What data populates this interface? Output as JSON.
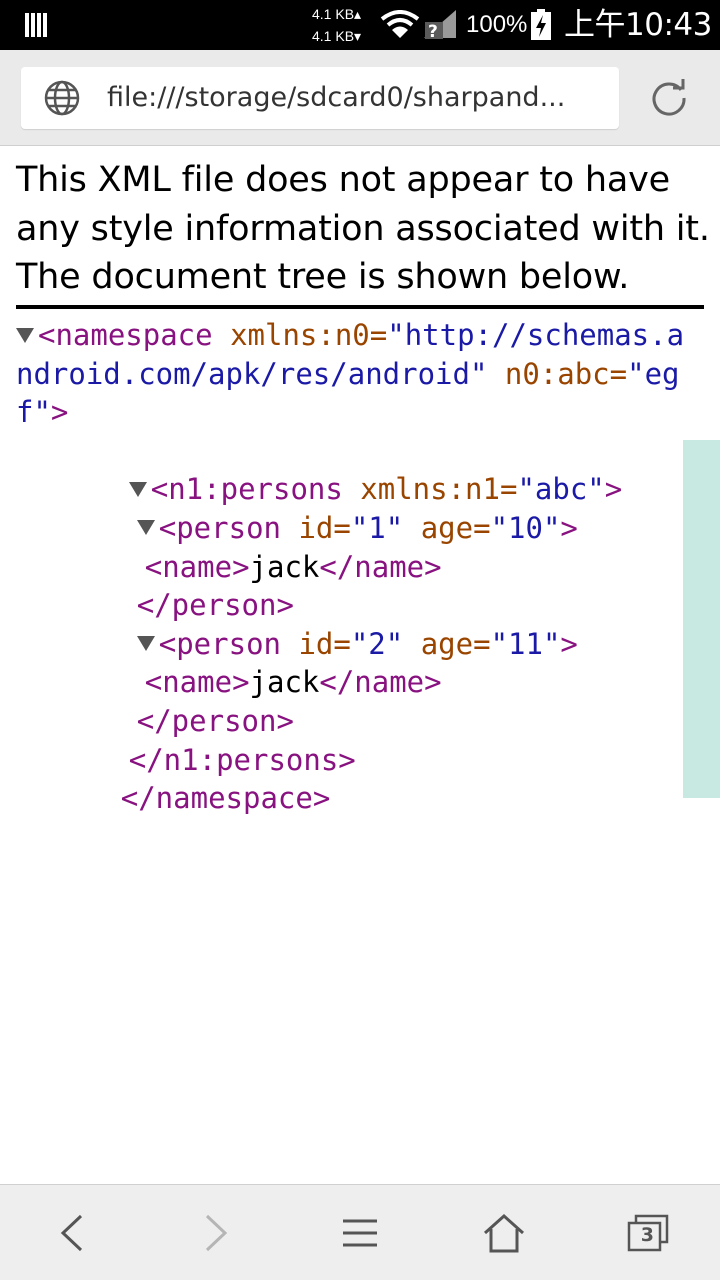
{
  "status_bar": {
    "net_up": "4.1 KB▴",
    "net_down": "4.1 KB▾",
    "battery": "100%",
    "time": "上午10:43",
    "icons": [
      "notification-icon",
      "wifi-icon",
      "signal-icon",
      "battery-charging-icon"
    ]
  },
  "address_bar": {
    "url": "file:///storage/sdcard0/sharpand...",
    "icons": [
      "globe-icon",
      "refresh-icon"
    ]
  },
  "content": {
    "info_message": "This XML file does not appear to have any style information associated with it. The document tree is shown below.",
    "xml": {
      "root_open": "<namespace",
      "root_ns_attr": "xmlns:n0",
      "root_ns_val": "\"http://schemas.android.com/apk/res/android\"",
      "root_attr2": "n0:abc",
      "root_val2": "\"egf\"",
      "persons_open": "<n1:persons",
      "persons_attr": "xmlns:n1",
      "persons_val": "\"abc\"",
      "persons_close": "</n1:persons>",
      "root_close": "</namespace>",
      "persons": [
        {
          "id": "\"1\"",
          "age": "\"10\"",
          "name": "jack"
        },
        {
          "id": "\"2\"",
          "age": "\"11\"",
          "name": "jack"
        }
      ],
      "person_open": "<person",
      "attr_id": "id",
      "attr_age": "age",
      "name_open": "<name>",
      "name_close": "</name>",
      "person_close": "</person>",
      "eq": "=",
      "gt": ">"
    }
  },
  "bottom_nav": {
    "tab_count": "3",
    "icons": [
      "back-icon",
      "forward-icon",
      "menu-icon",
      "home-icon",
      "tabs-icon"
    ]
  },
  "colors": {
    "tag": "#881280",
    "attribute": "#994500",
    "value": "#1a1aa6",
    "scrollbar": "#c7e9e2"
  }
}
